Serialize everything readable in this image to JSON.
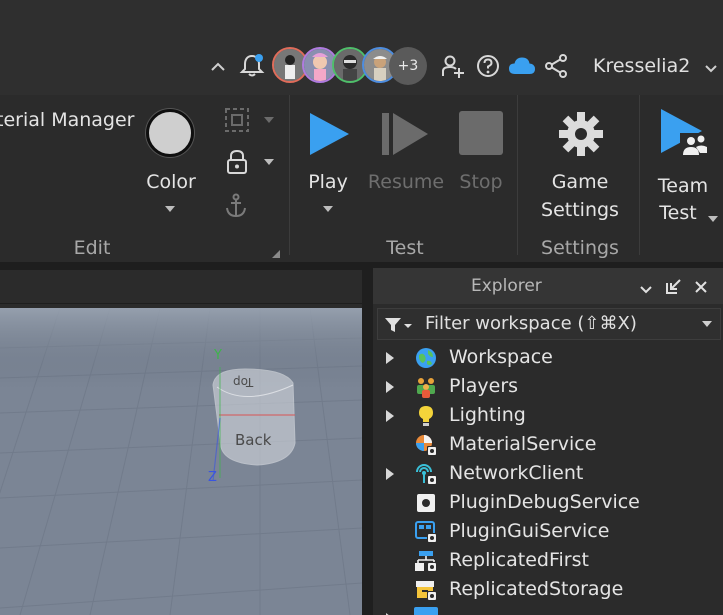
{
  "titlebar": {
    "avatars_more": "+3",
    "username": "Kresselia2",
    "icons": [
      "collapse-chevron-icon",
      "notification-bell-icon",
      "add-friend-icon",
      "help-icon",
      "cloud-icon",
      "share-icon"
    ]
  },
  "ribbon": {
    "material_manager": "terial Manager",
    "color_label": "Color",
    "edit_group": "Edit",
    "play_label": "Play",
    "resume_label": "Resume",
    "stop_label": "Stop",
    "test_group": "Test",
    "game_settings_line1": "Game",
    "game_settings_line2": "Settings",
    "settings_group": "Settings",
    "team_test_line1": "Team",
    "team_test_line2": "Test"
  },
  "explorer": {
    "title": "Explorer",
    "filter_placeholder": "Filter workspace (⇧⌘X)",
    "items": [
      {
        "label": "Workspace",
        "expandable": true,
        "icon": "workspace-icon"
      },
      {
        "label": "Players",
        "expandable": true,
        "icon": "players-icon"
      },
      {
        "label": "Lighting",
        "expandable": true,
        "icon": "lighting-icon"
      },
      {
        "label": "MaterialService",
        "expandable": false,
        "icon": "material-service-icon"
      },
      {
        "label": "NetworkClient",
        "expandable": true,
        "icon": "network-client-icon"
      },
      {
        "label": "PluginDebugService",
        "expandable": false,
        "icon": "plugin-debug-icon"
      },
      {
        "label": "PluginGuiService",
        "expandable": false,
        "icon": "plugin-gui-icon"
      },
      {
        "label": "ReplicatedFirst",
        "expandable": false,
        "icon": "replicated-first-icon"
      },
      {
        "label": "ReplicatedStorage",
        "expandable": false,
        "icon": "replicated-storage-icon"
      }
    ]
  },
  "viewport": {
    "cube_top_label": "Top",
    "cube_back_label": "Back",
    "axis_y": "Y",
    "axis_z": "Z"
  },
  "colors": {
    "accent_blue": "#3aa0f0",
    "panel_bg": "#2b2b2b",
    "header_bg": "#353535"
  }
}
